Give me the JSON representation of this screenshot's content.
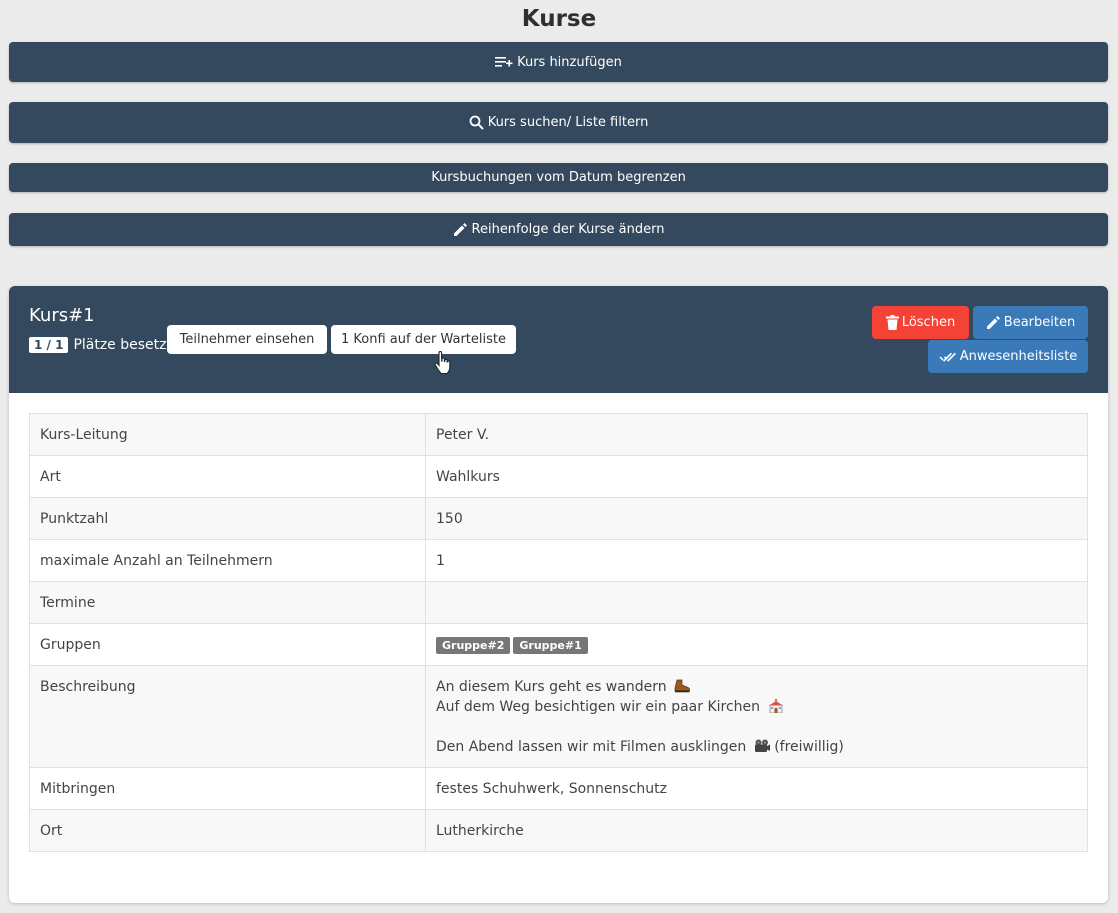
{
  "page": {
    "title": "Kurse"
  },
  "actions": {
    "add_label": "Kurs hinzufügen",
    "search_label": "Kurs suchen/ Liste filtern",
    "limit_label": "Kursbuchungen vom Datum begrenzen",
    "order_label": "Reihenfolge der Kurse ändern"
  },
  "course": {
    "title": "Kurs#1",
    "places_badge": "1 / 1",
    "places_label": "Plätze besetzt",
    "participants_button": "Teilnehmer einsehen",
    "waitlist_button": "1 Konfi auf der Warteliste",
    "delete_button": "Löschen",
    "edit_button": "Bearbeiten",
    "attendance_button": "Anwesenheitsliste",
    "details": {
      "leader_key": "Kurs-Leitung",
      "leader_value": "Peter V.",
      "type_key": "Art",
      "type_value": "Wahlkurs",
      "points_key": "Punktzahl",
      "points_value": "150",
      "max_key": "maximale Anzahl an Teilnehmern",
      "max_value": "1",
      "dates_key": "Termine",
      "dates_value": "",
      "groups_key": "Gruppen",
      "groups": [
        "Gruppe#2",
        "Gruppe#1"
      ],
      "description_key": "Beschreibung",
      "description_lines": [
        "An diesem Kurs geht es wandern",
        "Auf dem Weg besichtigen wir ein paar Kirchen",
        "Den Abend lassen wir mit Filmen ausklingen",
        "(freiwillig)"
      ],
      "bring_key": "Mitbringen",
      "bring_value": "festes Schuhwerk, Sonnenschutz",
      "location_key": "Ort",
      "location_value": "Lutherkirche"
    }
  },
  "colors": {
    "header": "#34495e",
    "delete": "#f44336",
    "primary": "#3a7ab9",
    "badge": "#777777"
  }
}
